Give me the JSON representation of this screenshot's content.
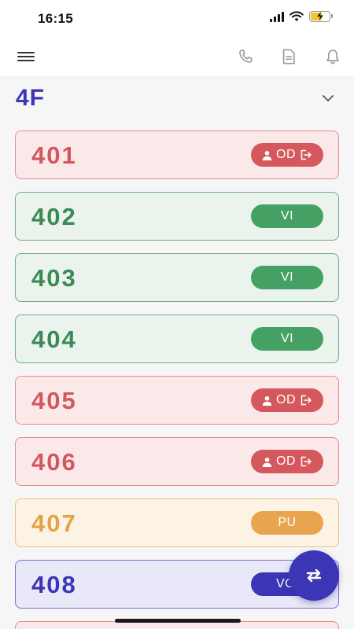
{
  "status_bar": {
    "time": "16:15"
  },
  "header": {
    "menu_icon": "hamburger-menu-icon",
    "actions": [
      "phone-icon",
      "document-icon",
      "bell-icon"
    ]
  },
  "floor": {
    "title": "4F",
    "toggle_icon": "chevron-down-icon"
  },
  "rooms": [
    {
      "number": "401",
      "status": "OD"
    },
    {
      "number": "402",
      "status": "VI"
    },
    {
      "number": "403",
      "status": "VI"
    },
    {
      "number": "404",
      "status": "VI"
    },
    {
      "number": "405",
      "status": "OD"
    },
    {
      "number": "406",
      "status": "OD"
    },
    {
      "number": "407",
      "status": "PU"
    },
    {
      "number": "408",
      "status": "VC"
    }
  ],
  "fab": {
    "icon": "swap-arrows-icon"
  },
  "colors": {
    "accent": "#3c35b5",
    "occupied": "#d4585d",
    "vacant_inspected": "#45a064",
    "pick_up": "#e8a44e"
  }
}
